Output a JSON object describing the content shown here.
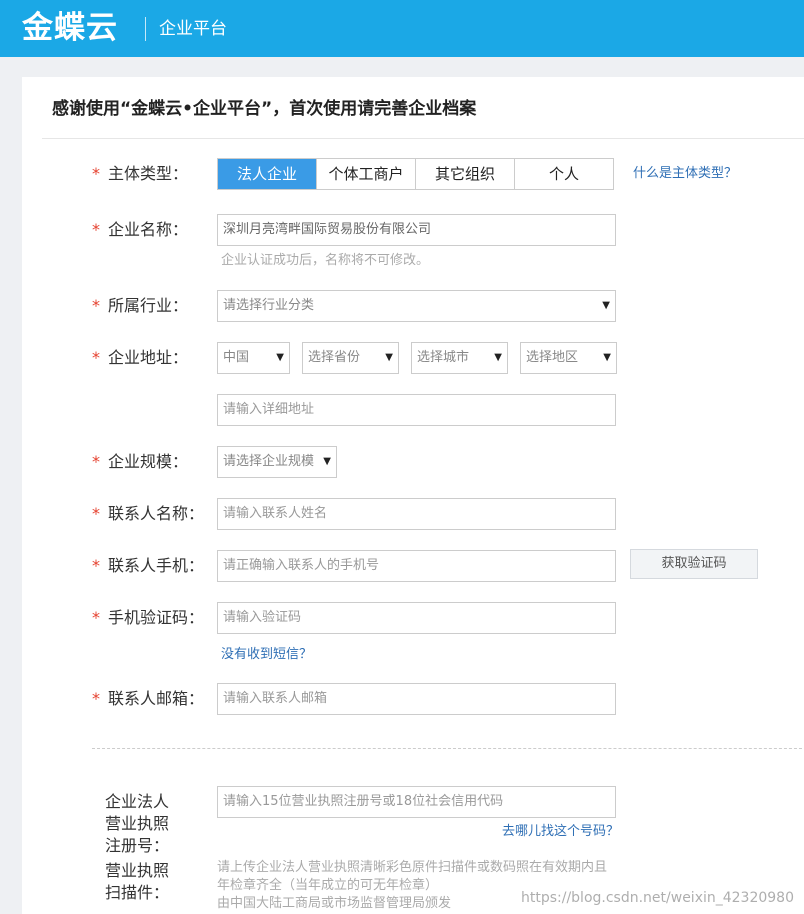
{
  "header": {
    "brand": "金蝶云",
    "platform": "企业平台"
  },
  "page": {
    "title": "感谢使用“金蝶云•企业平台”，首次使用请完善企业档案"
  },
  "required_mark": "*",
  "form": {
    "entity_type": {
      "label": "主体类型：",
      "options": [
        "法人企业",
        "个体工商户",
        "其它组织",
        "个人"
      ],
      "selected": "法人企业",
      "help_link": "什么是主体类型？"
    },
    "company_name": {
      "label": "企业名称：",
      "value": "深圳月亮湾畔国际贸易股份有限公司",
      "hint": "企业认证成功后，名称将不可修改。"
    },
    "industry": {
      "label": "所属行业：",
      "value": "请选择行业分类"
    },
    "address": {
      "label": "企业地址：",
      "country": "中国",
      "province": "选择省份",
      "city": "选择城市",
      "district": "选择地区",
      "detail_placeholder": "请输入详细地址"
    },
    "scale": {
      "label": "企业规模：",
      "value": "请选择企业规模"
    },
    "contact_name": {
      "label": "联系人名称：",
      "placeholder": "请输入联系人姓名"
    },
    "contact_phone": {
      "label": "联系人手机：",
      "placeholder": "请正确输入联系人的手机号",
      "get_code_button": "获取验证码"
    },
    "sms_code": {
      "label": "手机验证码：",
      "placeholder": "请输入验证码",
      "no_sms_link": "没有收到短信？"
    },
    "contact_email": {
      "label": "联系人邮箱：",
      "placeholder": "请输入联系人邮箱"
    },
    "license_no": {
      "label_lines": [
        "企业法人",
        "营业执照",
        "注册号："
      ],
      "placeholder": "请输入15位营业执照注册号或18位社会信用代码",
      "help_link": "去哪儿找这个号码？"
    },
    "license_scan": {
      "label_lines": [
        "营业执照",
        "扫描件："
      ],
      "note_lines": [
        "请上传企业法人营业执照清晰彩色原件扫描件或数码照在有效期内且",
        "年检章齐全（当年成立的可无年检章）",
        "由中国大陆工商局或市场监督管理局颁发"
      ]
    }
  },
  "watermark": "https://blog.csdn.net/weixin_42320980",
  "icons": {
    "dropdown_caret": "▼"
  },
  "colors": {
    "header_bg": "#1ba8e6",
    "active_tab": "#3a9be6",
    "required": "#e5402e",
    "link": "#2f6fb5"
  }
}
